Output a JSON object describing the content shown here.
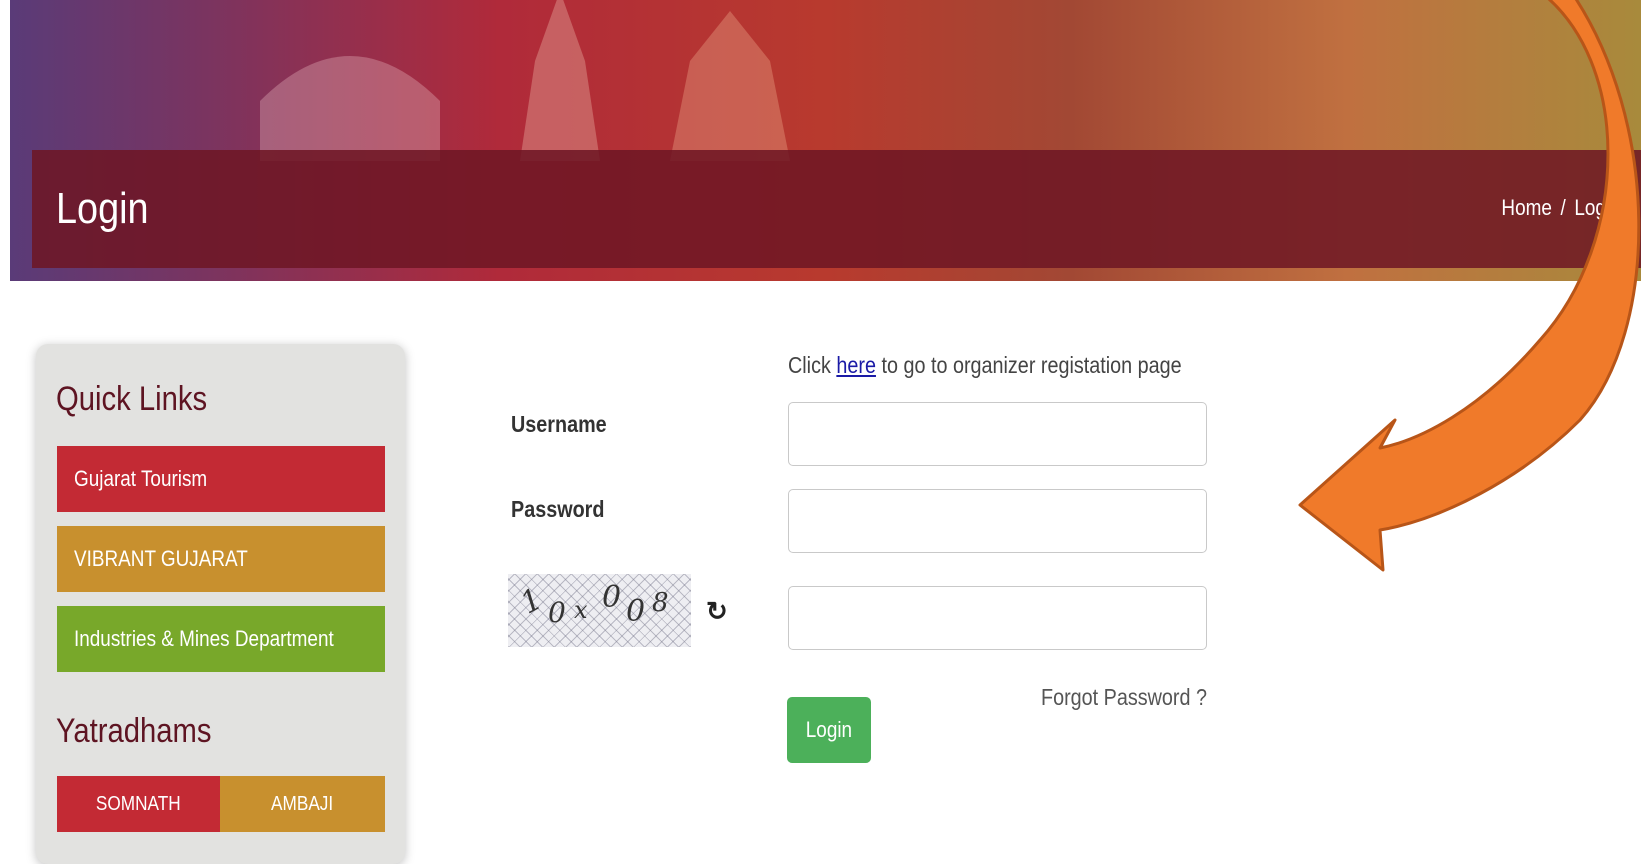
{
  "header": {
    "title": "Login",
    "breadcrumb": {
      "home": "Home",
      "separator": "/",
      "current": "Login"
    }
  },
  "sidebar": {
    "quick_links_heading": "Quick Links",
    "quick_links": [
      {
        "label": "Gujarat Tourism",
        "color": "#c32a34"
      },
      {
        "label": "VIBRANT GUJARAT",
        "color": "#c8902e"
      },
      {
        "label": "Industries & Mines Department",
        "color": "#78a82a"
      }
    ],
    "yatradhams_heading": "Yatradhams",
    "yatradhams": [
      {
        "label": "SOMNATH",
        "color": "#c32a34"
      },
      {
        "label": "AMBAJI",
        "color": "#c8902e"
      }
    ]
  },
  "form": {
    "register_prefix": "Click ",
    "register_link": "here",
    "register_suffix": " to go to organizer registation page",
    "username_label": "Username",
    "username_value": "",
    "password_label": "Password",
    "password_value": "",
    "captcha_text": "10x008",
    "captcha_input_value": "",
    "forgot_password": "Forgot Password ?",
    "login_button": "Login"
  },
  "colors": {
    "header_band": "#6e1624",
    "heading_text": "#5e1422",
    "login_button": "#4cb05a",
    "annotation_arrow": "#f07a2a"
  }
}
